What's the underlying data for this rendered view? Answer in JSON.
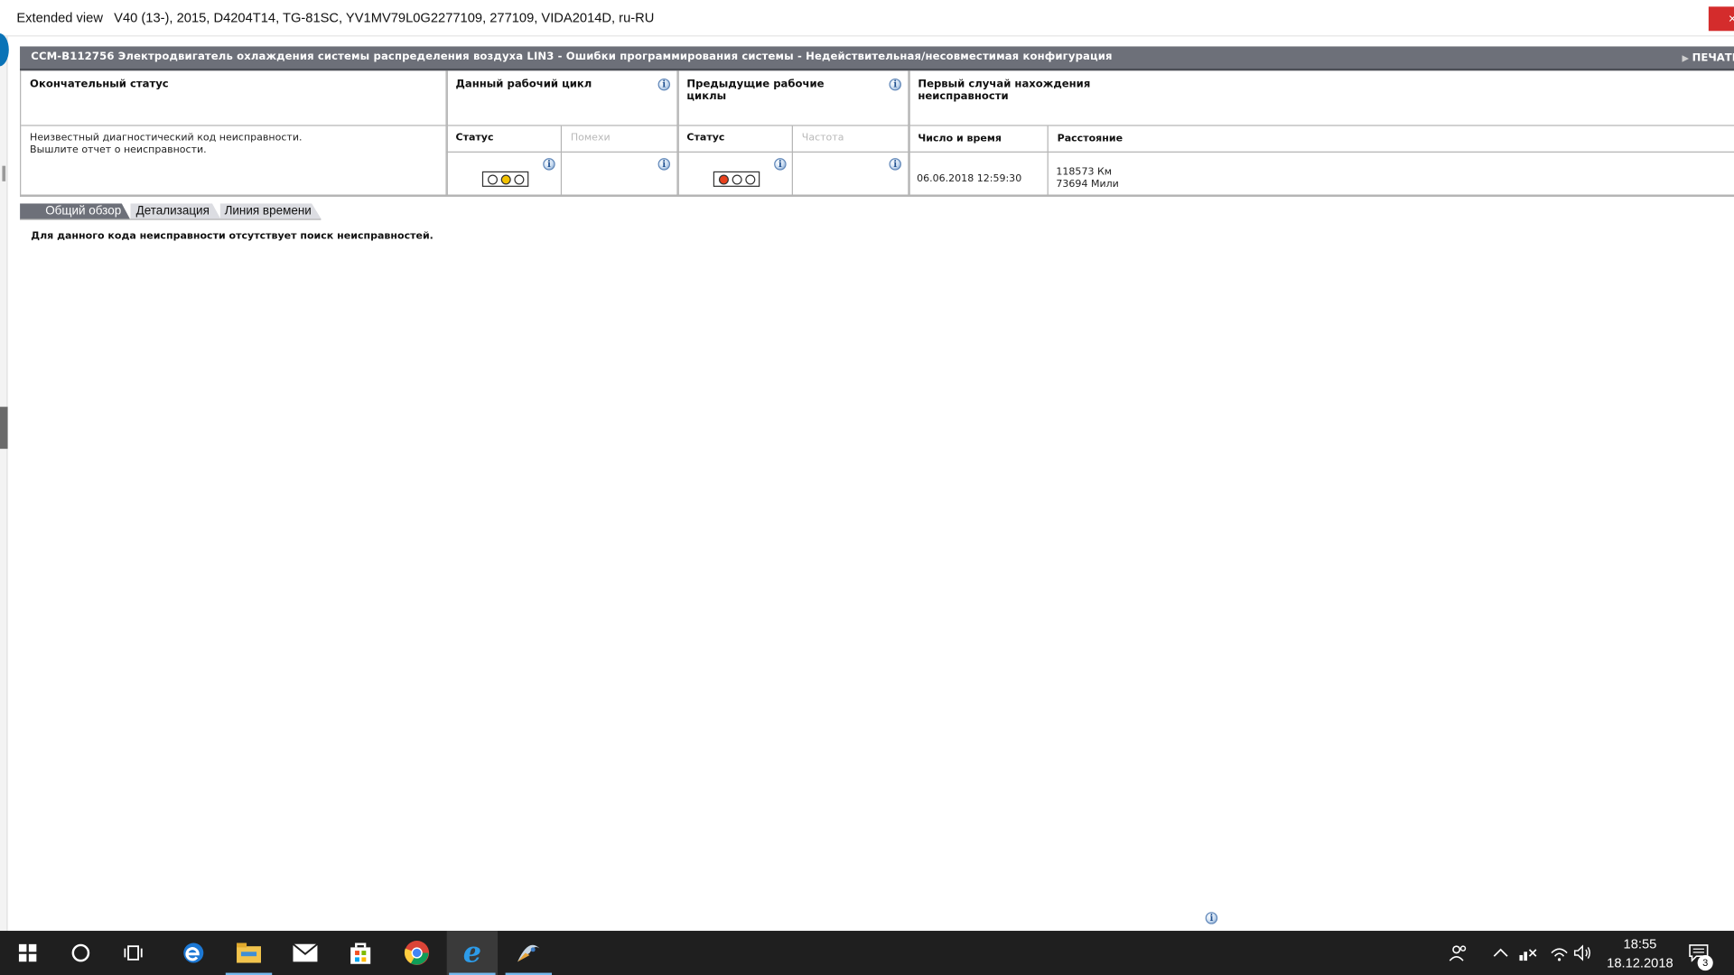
{
  "window": {
    "title": "Extended view   V40 (13-), 2015, D4204T14, TG-81SC, YV1MV79L0G2277109, 277109, VIDA2014D, ru-RU",
    "close_label": "×"
  },
  "dtc": {
    "title": "CCM-B112756 Электродвигатель охлаждения системы распределения воздуха LIN3 - Ошибки программирования системы - Недействительная/несовместимая конфигурация",
    "print_label": "ПЕЧАТЬ"
  },
  "status_table": {
    "final_status": {
      "header": "Окончательный статус",
      "text_line1": "Неизвестный диагностический код неисправности.",
      "text_line2": "Вышлите отчет о неисправности."
    },
    "current_cycle": {
      "header": "Данный рабочий цикл",
      "status_label": "Статус",
      "interference_label": "Помехи",
      "lamp": [
        "off",
        "yellow",
        "off"
      ]
    },
    "previous_cycles": {
      "header_line1": "Предыдущие рабочие",
      "header_line2": "циклы",
      "status_label": "Статус",
      "frequency_label": "Частота",
      "lamp": [
        "red",
        "off",
        "off"
      ]
    },
    "first_occurrence": {
      "header_line1": "Первый случай нахождения",
      "header_line2": "неисправности",
      "datetime_label": "Число и время",
      "distance_label": "Расстояние",
      "datetime_value": "06.06.2018 12:59:30",
      "distance_km": "118573 Км",
      "distance_mi": "73694 Мили"
    }
  },
  "tabs": [
    {
      "label": "Общий обзор",
      "active": true
    },
    {
      "label": "Детализация",
      "active": false
    },
    {
      "label": "Линия времени",
      "active": false
    }
  ],
  "message": "Для данного кода неисправности отсутствует поиск неисправностей.",
  "taskbar": {
    "time": "18:55",
    "date": "18.12.2018",
    "notification_count": "3",
    "apps": [
      "start-icon",
      "cortana-icon",
      "task-view-icon",
      "edge-icon",
      "file-explorer-icon",
      "mail-icon",
      "store-icon",
      "chrome-icon",
      "internet-explorer-icon",
      "vida-app-icon"
    ]
  },
  "colors": {
    "header_bar": "#6d7079",
    "lamp_yellow": "#f2c200",
    "lamp_red": "#e8401c",
    "close_red": "#d42c2c",
    "taskbar": "#1f1f1f"
  }
}
